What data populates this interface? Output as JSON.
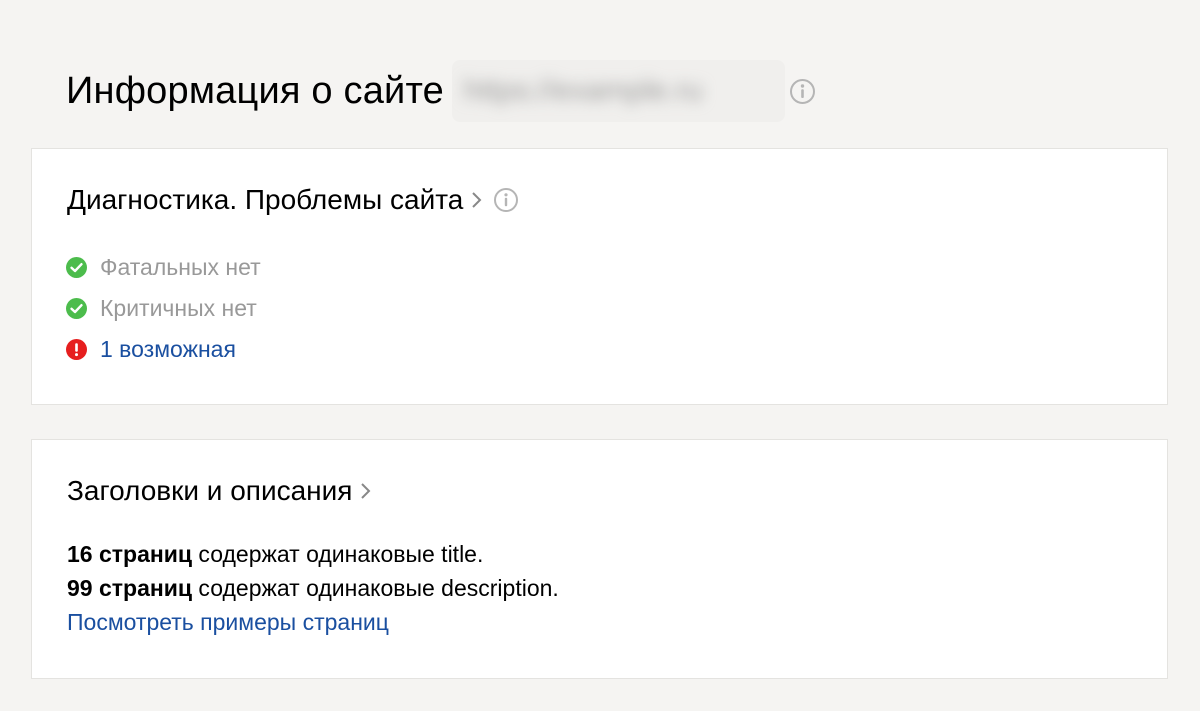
{
  "header": {
    "title": "Информация о сайте",
    "site_url": "https://example.ru",
    "info_icon": "info-icon"
  },
  "diagnostics": {
    "title": "Диагностика. Проблемы сайта",
    "chevron_icon": "chevron-right-icon",
    "info_icon": "info-icon",
    "items": [
      {
        "icon": "check-circle-icon",
        "color": "#4cbc4c",
        "label": "Фатальных нет",
        "style": "muted"
      },
      {
        "icon": "check-circle-icon",
        "color": "#4cbc4c",
        "label": "Критичных нет",
        "style": "muted"
      },
      {
        "icon": "exclamation-circle-icon",
        "color": "#e61e1e",
        "label": "1 возможная",
        "style": "link"
      }
    ]
  },
  "meta": {
    "title": "Заголовки и описания",
    "chevron_icon": "chevron-right-icon",
    "lines": [
      {
        "count": "16 страниц",
        "text": " содержат одинаковые title."
      },
      {
        "count": "99 страниц",
        "text": " содержат одинаковые description."
      }
    ],
    "link": "Посмотреть примеры страниц"
  },
  "colors": {
    "background": "#f5f4f2",
    "link": "#1a4fa0",
    "ok": "#4cbc4c",
    "error": "#e61e1e",
    "muted": "#999999"
  }
}
